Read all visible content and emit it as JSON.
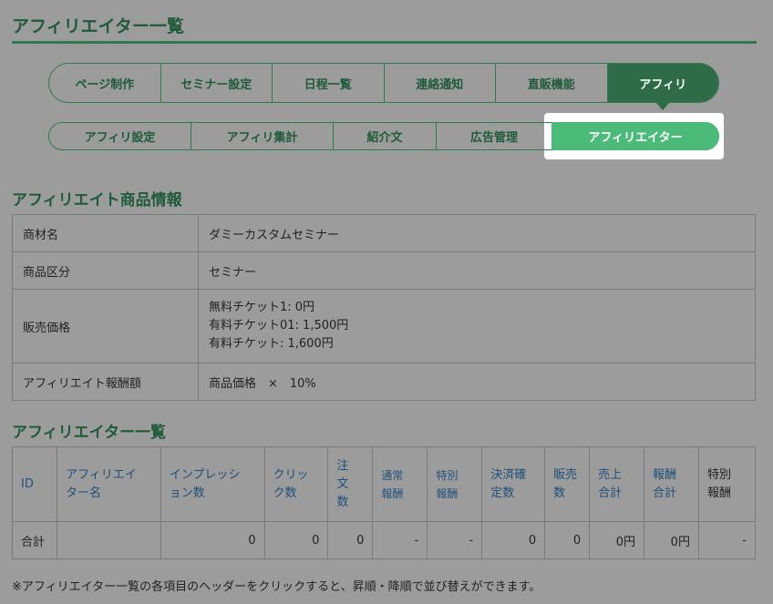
{
  "page": {
    "title": "アフィリエイター一覧"
  },
  "main_tabs": [
    {
      "label": "ページ制作"
    },
    {
      "label": "セミナー設定"
    },
    {
      "label": "日程一覧"
    },
    {
      "label": "連絡通知"
    },
    {
      "label": "直販機能"
    },
    {
      "label": "アフィリ"
    }
  ],
  "sub_tabs": [
    {
      "label": "アフィリ設定"
    },
    {
      "label": "アフィリ集計"
    },
    {
      "label": "紹介文"
    },
    {
      "label": "広告管理"
    },
    {
      "label": "アフィリエイター"
    }
  ],
  "product_info": {
    "title": "アフィリエイト商品情報",
    "rows": [
      {
        "label": "商材名",
        "value": "ダミーカスタムセミナー"
      },
      {
        "label": "商品区分",
        "value": "セミナー"
      },
      {
        "label": "販売価格",
        "lines": [
          "無料チケット1: 0円",
          "有料チケット01: 1,500円",
          "有料チケット: 1,600円"
        ]
      },
      {
        "label": "アフィリエイト報酬額",
        "value": "商品価格　×　10%"
      }
    ]
  },
  "affiliate_list": {
    "title": "アフィリエイター一覧",
    "headers": [
      "ID",
      "アフィリエイター名",
      "インプレッション数",
      "クリック数",
      "注文数",
      "通常報酬",
      "特別報酬",
      "決済確定数",
      "販売数",
      "売上合計",
      "報酬合計",
      "特別報酬"
    ],
    "header_lines": [
      [
        "ID"
      ],
      [
        "アフィリエイ",
        "ター名"
      ],
      [
        "インプレッシ",
        "ョン数"
      ],
      [
        "クリッ",
        "ク数"
      ],
      [
        "注",
        "文",
        "数"
      ],
      [
        "通常",
        "報酬"
      ],
      [
        "特別",
        "報酬"
      ],
      [
        "決済確",
        "定数"
      ],
      [
        "販売",
        "数"
      ],
      [
        "売上",
        "合計"
      ],
      [
        "報酬",
        "合計"
      ],
      [
        "特別",
        "報酬"
      ]
    ],
    "total_row": [
      "合計",
      "",
      "0",
      "0",
      "0",
      "-",
      "-",
      "0",
      "0",
      "0円",
      "0円",
      "-"
    ]
  },
  "note": "※アフィリエイター一覧の各項目のヘッダーをクリックすると、昇順・降順で並び替えができます。"
}
